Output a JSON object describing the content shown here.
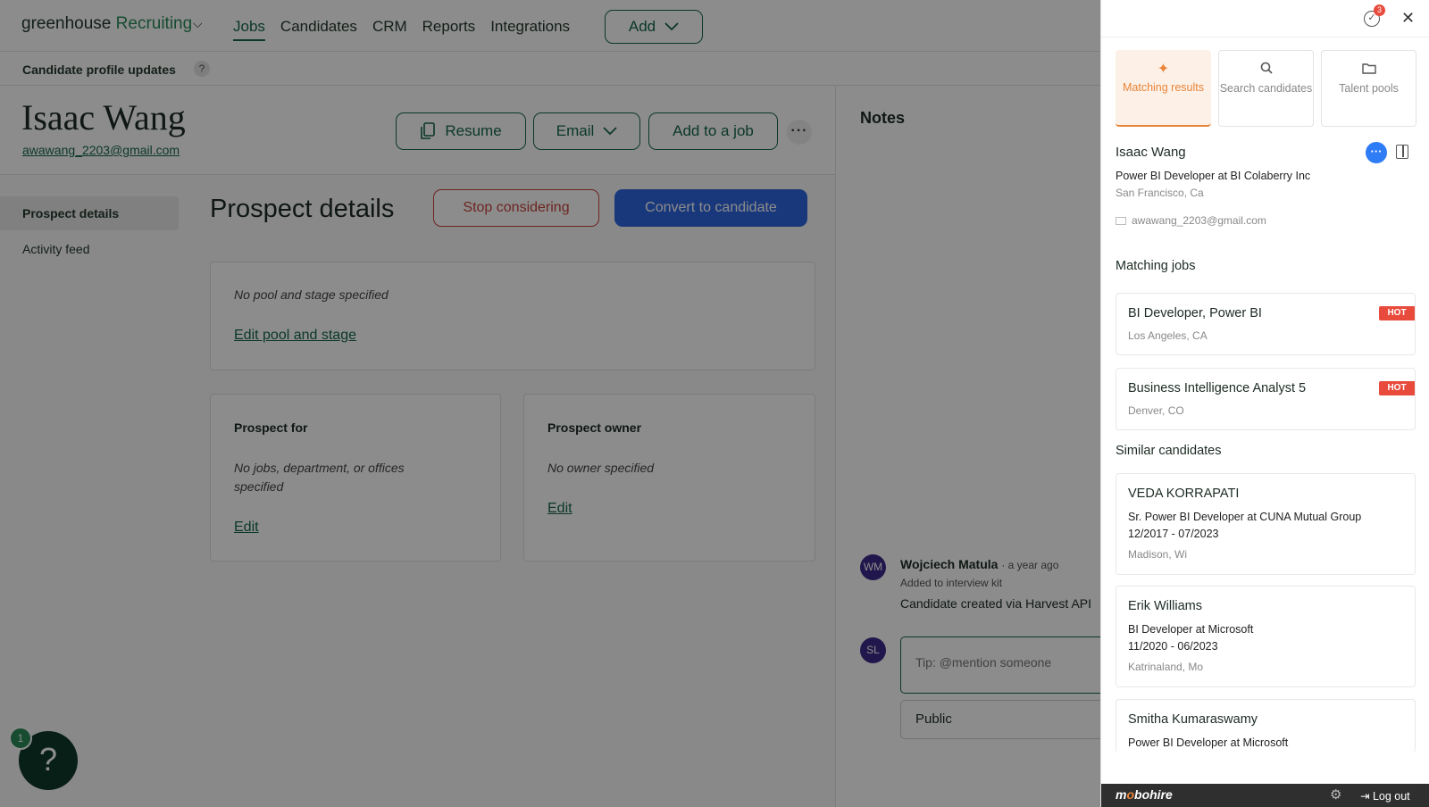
{
  "app": {
    "brand": "greenhouse",
    "brand_suffix": "Recruiting",
    "nav": [
      "Jobs",
      "Candidates",
      "CRM",
      "Reports",
      "Integrations"
    ],
    "add_label": "Add",
    "subbar_title": "Candidate profile updates",
    "help_q": "?"
  },
  "candidate": {
    "name": "Isaac Wang",
    "email": "awawang_2203@gmail.com",
    "actions": {
      "resume": "Resume",
      "email": "Email",
      "add_job": "Add to a job"
    }
  },
  "leftnav": [
    "Prospect details",
    "Activity feed"
  ],
  "prospect": {
    "title": "Prospect details",
    "stop": "Stop considering",
    "convert": "Convert to candidate",
    "pool_text": "No pool and stage specified",
    "pool_link": "Edit pool and stage",
    "for_title": "Prospect for",
    "for_text": "No jobs, department, or offices specified",
    "for_link": "Edit",
    "owner_title": "Prospect owner",
    "owner_text": "No owner specified",
    "owner_link": "Edit"
  },
  "notes": {
    "title": "Notes",
    "author_initials": "WM",
    "author": "Wojciech Matula",
    "time": "· a year ago",
    "sub": "Added to interview kit",
    "body": "Candidate created via Harvest API",
    "me_initials": "SL",
    "tip_placeholder": "Tip: @mention someone",
    "visibility": "Public"
  },
  "help": {
    "badge": "1"
  },
  "panel": {
    "notif_count": "3",
    "tabs": [
      {
        "label": "Matching results",
        "icon": "sparkle-icon"
      },
      {
        "label": "Search candidates",
        "icon": "search-icon"
      },
      {
        "label": "Talent pools",
        "icon": "folder-icon"
      }
    ],
    "profile": {
      "name": "Isaac Wang",
      "role": "Power BI Developer at BI Colaberry Inc",
      "location": "San Francisco, Ca",
      "email": "awawang_2203@gmail.com"
    },
    "matching_title": "Matching jobs",
    "jobs": [
      {
        "title": "BI Developer, Power BI",
        "location": "Los Angeles, CA",
        "badge": "HOT"
      },
      {
        "title": "Business Intelligence Analyst 5",
        "location": "Denver, CO",
        "badge": "HOT"
      }
    ],
    "similar_title": "Similar candidates",
    "similar": [
      {
        "name": "VEDA KORRAPATI",
        "role": "Sr. Power BI Developer at CUNA Mutual Group",
        "dates": "12/2017 - 07/2023",
        "location": "Madison, Wi"
      },
      {
        "name": "Erik Williams",
        "role": "BI Developer at Microsoft",
        "dates": "11/2020 - 06/2023",
        "location": "Katrinaland, Mo"
      },
      {
        "name": "Smitha Kumaraswamy",
        "role": "Power BI Developer at Microsoft",
        "dates": "",
        "location": ""
      }
    ],
    "footer": {
      "logo_a": "m",
      "logo_b": "o",
      "logo_c": "bohire",
      "logout": "Log out"
    }
  }
}
